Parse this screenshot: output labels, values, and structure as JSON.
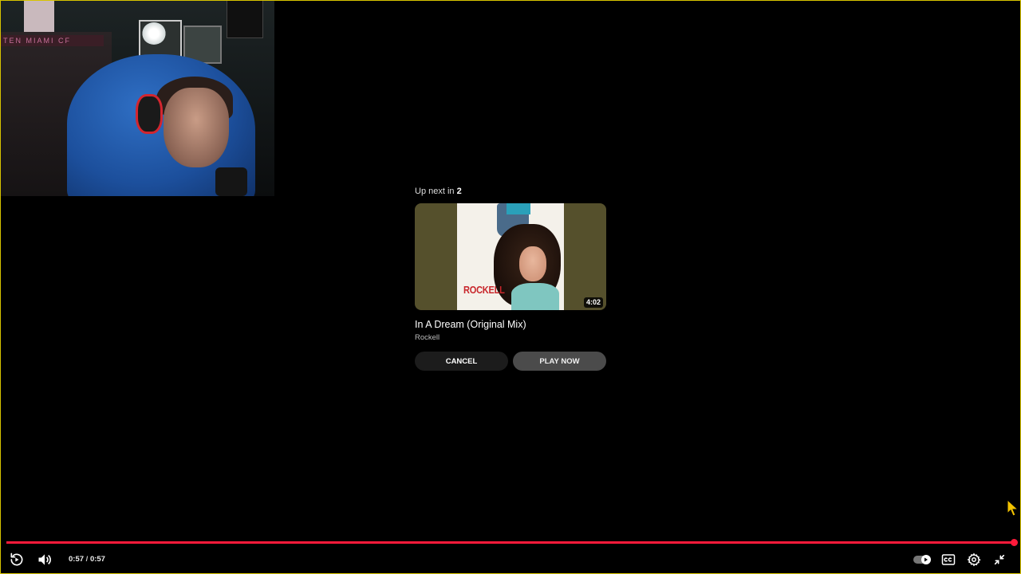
{
  "webcam": {
    "banner_text": "TEN MIAMI CF"
  },
  "up_next": {
    "label": "Up next in",
    "countdown": "2",
    "thumbnail": {
      "cover_brand": "ROCKELL",
      "duration": "4:02"
    },
    "title": "In A Dream (Original Mix)",
    "channel": "Rockell",
    "cancel_label": "CANCEL",
    "play_now_label": "PLAY NOW"
  },
  "player": {
    "accent_color": "#ff1a3a",
    "progress_fraction": 1.0,
    "current_time": "0:57",
    "separator": "/",
    "total_time": "0:57",
    "icons": {
      "replay": "replay-icon",
      "volume": "volume-icon",
      "autoplay": "autoplay-toggle-icon",
      "captions": "captions-icon",
      "settings": "gear-icon",
      "exit_fullscreen": "exit-fullscreen-icon"
    }
  }
}
